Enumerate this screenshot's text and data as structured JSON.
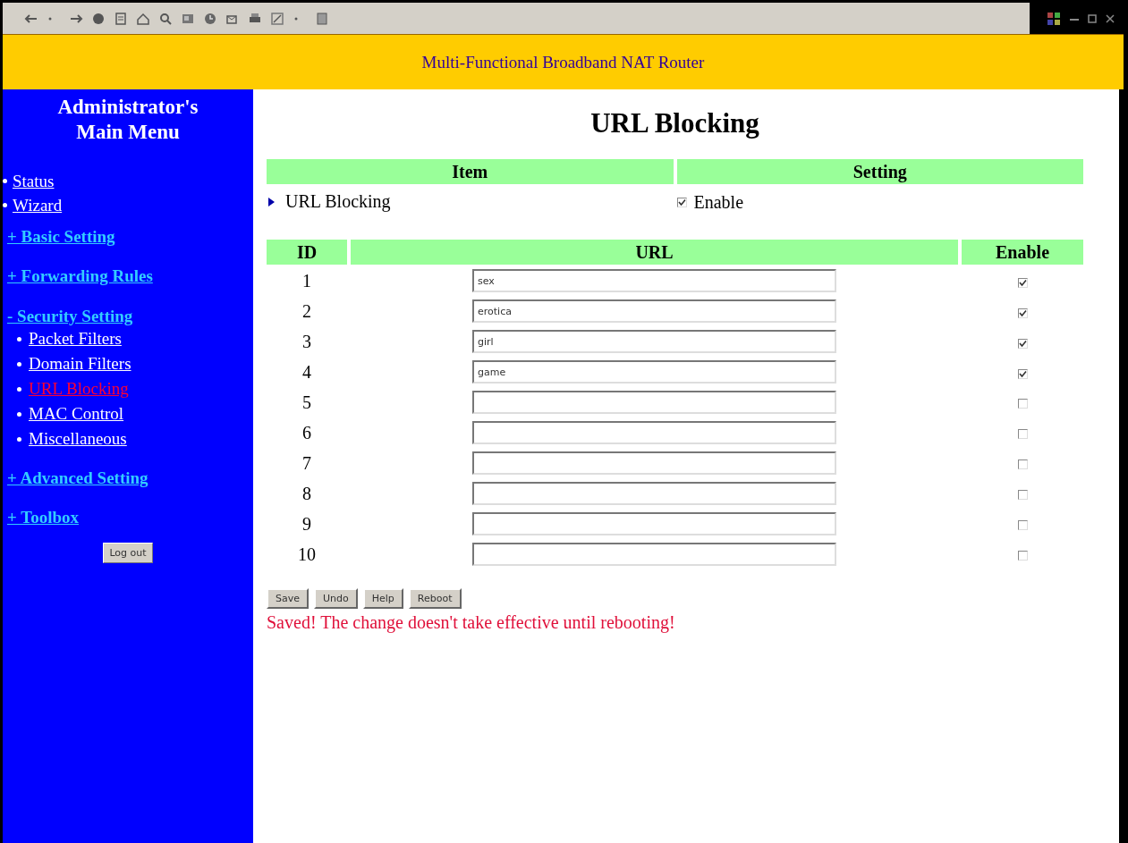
{
  "header": {
    "title": "Multi-Functional Broadband NAT Router"
  },
  "sidebar": {
    "title": "Administrator's Main Menu",
    "items": [
      {
        "kind": "link",
        "label": "Status"
      },
      {
        "kind": "link",
        "label": "Wizard"
      },
      {
        "kind": "group",
        "label": "+ Basic Setting"
      },
      {
        "kind": "group",
        "label": "+ Forwarding Rules"
      },
      {
        "kind": "group",
        "label": "- Security Setting",
        "children": [
          {
            "label": "Packet Filters",
            "selected": false
          },
          {
            "label": "Domain Filters",
            "selected": false
          },
          {
            "label": "URL Blocking",
            "selected": true
          },
          {
            "label": "MAC Control",
            "selected": false
          },
          {
            "label": "Miscellaneous",
            "selected": false
          }
        ]
      },
      {
        "kind": "group",
        "label": "+ Advanced Setting"
      },
      {
        "kind": "group",
        "label": "+ Toolbox"
      }
    ],
    "logout": "Log out"
  },
  "main": {
    "title": "URL Blocking",
    "settings_table": {
      "columns": [
        "Item",
        "Setting"
      ],
      "rows": [
        {
          "item": "URL Blocking",
          "option": "Enable",
          "checked": true
        }
      ]
    },
    "url_table": {
      "columns": [
        "ID",
        "URL",
        "Enable"
      ],
      "rows": [
        {
          "id": "1",
          "url": "sex",
          "checked": true
        },
        {
          "id": "2",
          "url": "erotica",
          "checked": true
        },
        {
          "id": "3",
          "url": "girl",
          "checked": true
        },
        {
          "id": "4",
          "url": "game",
          "checked": true
        },
        {
          "id": "5",
          "checked": false
        },
        {
          "id": "6",
          "checked": false
        },
        {
          "id": "7",
          "checked": false
        },
        {
          "id": "8",
          "checked": false
        },
        {
          "id": "9",
          "checked": false
        },
        {
          "id": "10",
          "checked": false
        }
      ]
    },
    "buttons": [
      "Save",
      "Undo",
      "Help",
      "Reboot"
    ],
    "message": "Saved! The change doesn't take effective until rebooting!"
  }
}
